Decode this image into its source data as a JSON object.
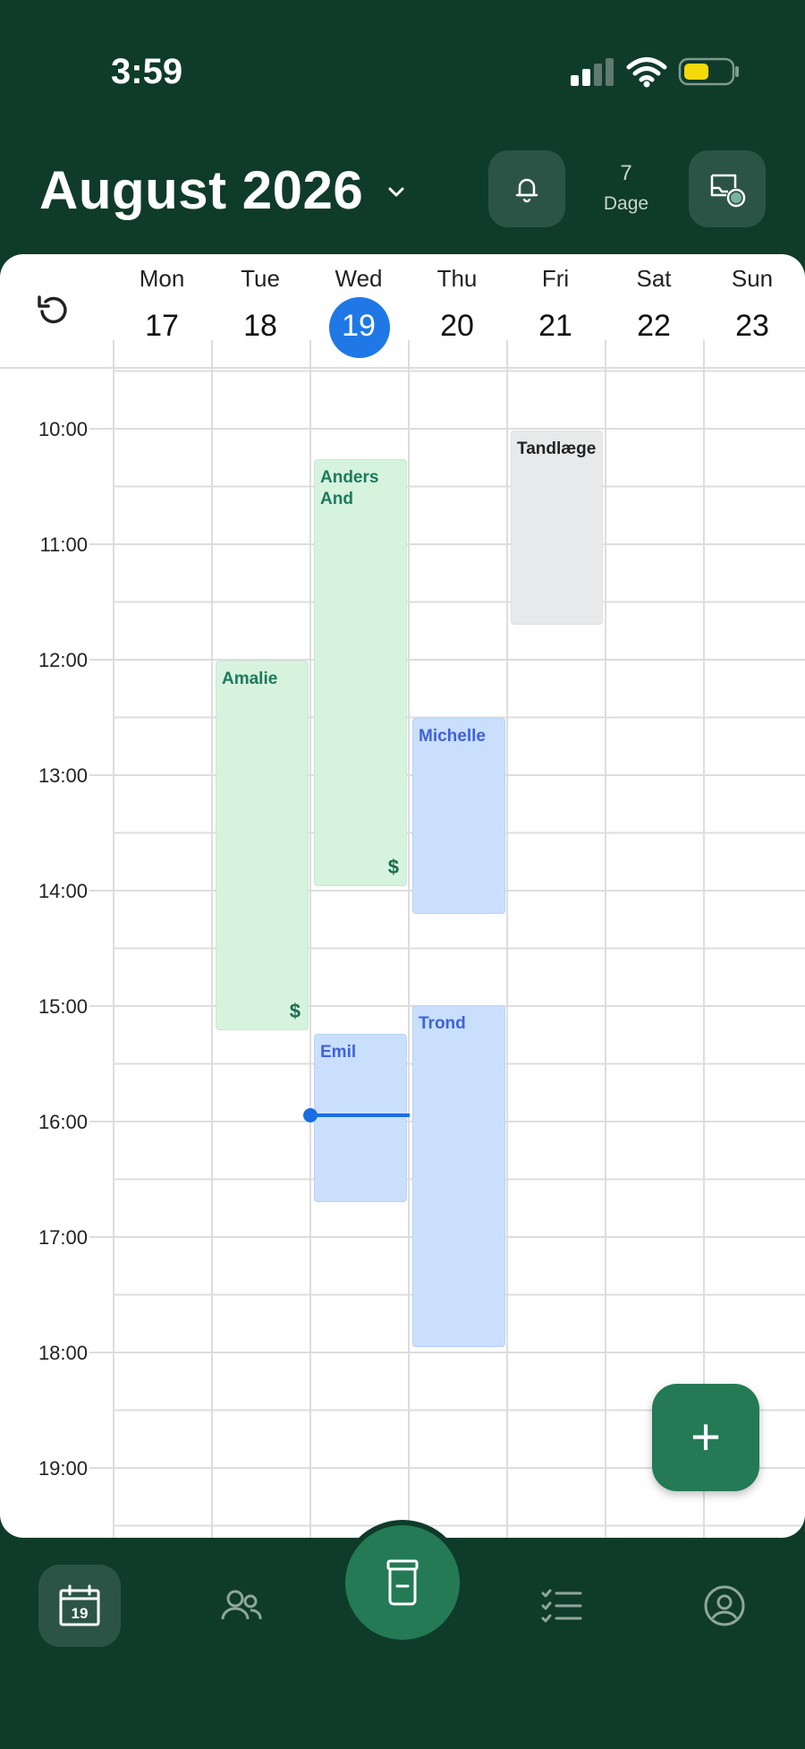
{
  "status_bar": {
    "time": "3:59"
  },
  "header": {
    "month_label": "August 2026",
    "days_count": "7",
    "days_label": "Dage"
  },
  "days": [
    {
      "name": "Mon",
      "date": "17"
    },
    {
      "name": "Tue",
      "date": "18"
    },
    {
      "name": "Wed",
      "date": "19"
    },
    {
      "name": "Thu",
      "date": "20"
    },
    {
      "name": "Fri",
      "date": "21"
    },
    {
      "name": "Sat",
      "date": "22"
    },
    {
      "name": "Sun",
      "date": "23"
    }
  ],
  "today_index": 2,
  "times": [
    "10:00",
    "11:00",
    "12:00",
    "13:00",
    "14:00",
    "15:00",
    "16:00",
    "17:00",
    "18:00",
    "19:00"
  ],
  "events": [
    {
      "title": "Tandlæge",
      "day": "Fri 21",
      "start": "10:00",
      "end": "11:45",
      "color": "grey",
      "paid": false
    },
    {
      "title": "Anders And",
      "day": "Wed 19",
      "start": "10:15",
      "end": "13:55",
      "color": "green",
      "paid": true
    },
    {
      "title": "Amalie",
      "day": "Tue 18",
      "start": "12:00",
      "end": "15:15",
      "color": "green",
      "paid": true
    },
    {
      "title": "Michelle",
      "day": "Thu 20",
      "start": "12:30",
      "end": "14:15",
      "color": "blue",
      "paid": false
    },
    {
      "title": "Trond",
      "day": "Thu 20",
      "start": "15:00",
      "end": "17:58",
      "color": "blue",
      "paid": false
    },
    {
      "title": "Emil",
      "day": "Wed 19",
      "start": "15:15",
      "end": "16:45",
      "color": "blue",
      "paid": false
    }
  ],
  "event_paid_symbol": "$",
  "now_time": "15:58",
  "fab": {
    "label": "+"
  },
  "nav": {
    "calendar_date": "19"
  },
  "colors": {
    "app_bg": "#0f3b2b",
    "accent": "#237a54",
    "today": "#1f78e6",
    "now_line": "#1a6fe0"
  }
}
